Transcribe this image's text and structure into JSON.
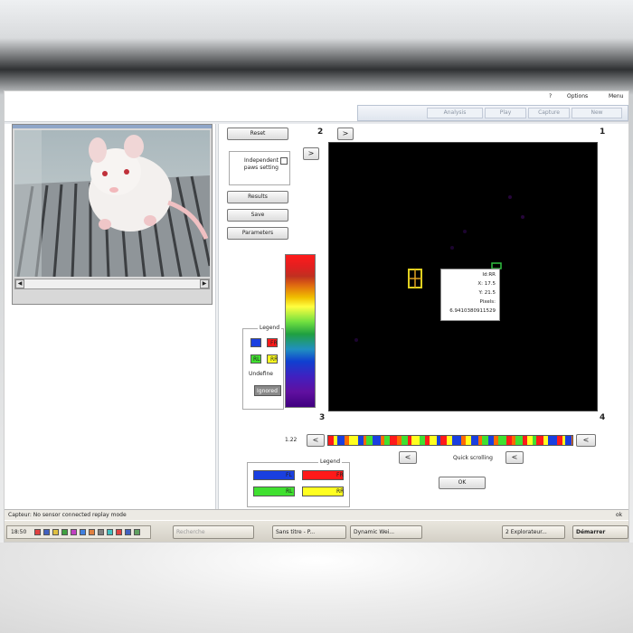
{
  "menu": {
    "items": [
      "Menu",
      "Options",
      "?"
    ]
  },
  "toolbar": {
    "tabs": [
      "New",
      "Capture",
      "Play",
      "Analysis"
    ]
  },
  "corners": {
    "c1": "1",
    "c2": "2",
    "c3": "3",
    "c4": "4"
  },
  "buttons": {
    "reset": "Reset",
    "results": "Results",
    "save": "Save",
    "parameters": "Parameters",
    "left_arrow_top": ">",
    "left_arrow_mid": ">",
    "strip_left_arrow": "<",
    "strip_right_arrow": "<",
    "ok": "OK"
  },
  "checkbox": {
    "label": "Independent paws setting",
    "checked": false
  },
  "legend_left": {
    "title": "Legend",
    "items": [
      {
        "name": "FL",
        "color": "#1a3fe0"
      },
      {
        "name": "FR",
        "color": "#ff1a1a"
      },
      {
        "name": "RL",
        "color": "#40e030"
      },
      {
        "name": "RR",
        "color": "#ffff20"
      }
    ],
    "undefine": "Undefine",
    "ignored": "Ignored"
  },
  "tooltip": {
    "lines": [
      "Id:RR",
      "X: 17.5",
      "Y: 21.5",
      "Pixels:",
      "6.9410380911529"
    ]
  },
  "strip": {
    "time": "1.22",
    "label": "Quick scrolling"
  },
  "legend_bottom": {
    "title": "Legend",
    "items": [
      {
        "name": "FL",
        "color": "#1a3fe0"
      },
      {
        "name": "FR",
        "color": "#ff1a1a"
      },
      {
        "name": "RL",
        "color": "#40e030"
      },
      {
        "name": "RR",
        "color": "#ffff20"
      }
    ]
  },
  "status": {
    "text": "Capteur: No sensor connected replay mode",
    "ok": "ok"
  },
  "taskbar": {
    "start": "Démarrer",
    "items": [
      "2 Explorateur...",
      "Dynamic Wei...",
      "Sans titre - P...",
      "Recherche"
    ],
    "time": "18:50"
  }
}
